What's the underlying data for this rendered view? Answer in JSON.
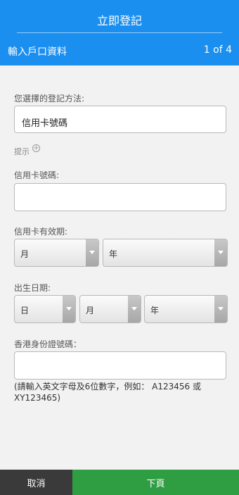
{
  "header": {
    "title": "立即登記",
    "subtitle": "輸入戶口資料",
    "step": "1 of 4"
  },
  "form": {
    "method_label": "您選擇的登記方法:",
    "method_value": "信用卡號碼",
    "hint_label": "提示",
    "hint_icon": "plus-circle-icon",
    "card_number_label": "信用卡號碼:",
    "card_number_value": "",
    "expiry_label": "信用卡有效期:",
    "expiry_month": "月",
    "expiry_year": "年",
    "dob_label": "出生日期:",
    "dob_day": "日",
    "dob_month": "月",
    "dob_year": "年",
    "hkid_label": "香港身份證號碼：",
    "hkid_value": "",
    "hkid_note": "(請輸入英文字母及6位數字，例如： A123456 或 XY123465)"
  },
  "footer": {
    "cancel_label": "取消",
    "next_label": "下頁"
  },
  "colors": {
    "header_bg": "#1a8ff0",
    "cancel_bg": "#3a3a3a",
    "next_bg": "#2f9e43",
    "page_bg": "#f2f2f2"
  }
}
